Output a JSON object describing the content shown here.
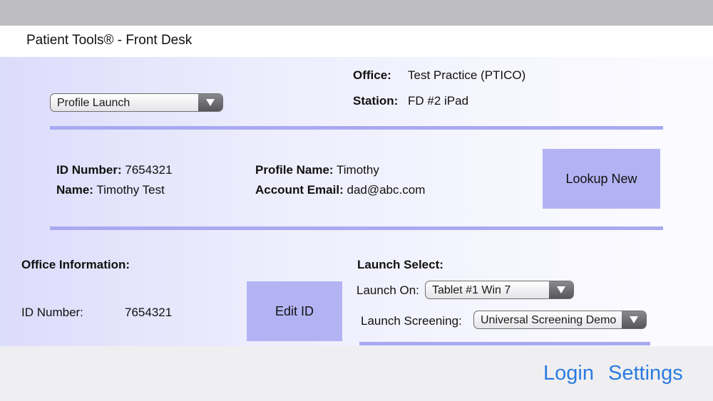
{
  "app": {
    "title": "Patient Tools® - Front Desk"
  },
  "header": {
    "mode_select": {
      "value": "Profile Launch",
      "icon": "chevron-down-icon"
    },
    "office_label": "Office:",
    "office_value": "Test Practice (PTICO)",
    "station_label": "Station:",
    "station_value": "FD #2 iPad"
  },
  "profile": {
    "id_label": "ID Number:",
    "id_value": "7654321",
    "name_label": "Name:",
    "name_value": "Timothy Test",
    "profile_name_label": "Profile Name:",
    "profile_name_value": "Timothy",
    "email_label": "Account Email:",
    "email_value": "dad@abc.com",
    "lookup_button": "Lookup New"
  },
  "office_info": {
    "heading": "Office Information:",
    "id_label": "ID Number:",
    "id_value": "7654321",
    "edit_button": "Edit ID"
  },
  "launch": {
    "heading": "Launch Select:",
    "launch_on_label": "Launch On:",
    "launch_on_value": "Tablet #1 Win 7",
    "screening_label": "Launch Screening:",
    "screening_value": "Universal Screening Demo"
  },
  "footer": {
    "login": "Login",
    "settings": "Settings"
  },
  "colors": {
    "accent_button": "#b3b3f4",
    "rule": "#a9a9f1",
    "link": "#2b7be0",
    "top_bar": "#bdbcc0"
  }
}
